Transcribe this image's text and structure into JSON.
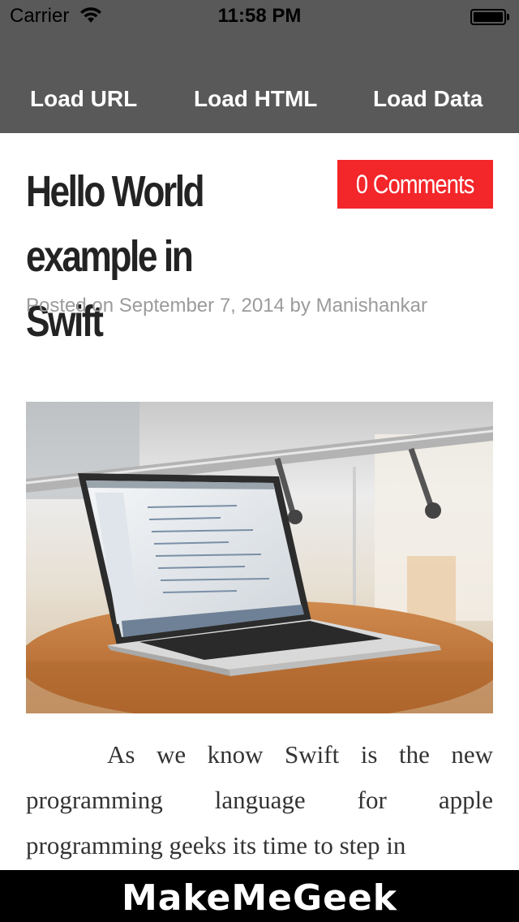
{
  "status_bar": {
    "carrier": "Carrier",
    "time": "11:58 PM"
  },
  "toolbar": {
    "load_url": "Load URL",
    "load_html": "Load HTML",
    "load_data": "Load Data"
  },
  "article": {
    "title": "Hello World example in Swift",
    "comments": "0 Comments",
    "meta": "Posted on September 7, 2014 by Manishankar",
    "image_icon": "laptop-photo",
    "body": "As we know Swift is the new programming language for apple programming geeks its time to step in"
  },
  "footer": {
    "brand": "MakeMeGeek"
  },
  "colors": {
    "toolbar_bg": "#595959",
    "comments_badge": "#f3262a",
    "footer_bg": "#000000"
  }
}
